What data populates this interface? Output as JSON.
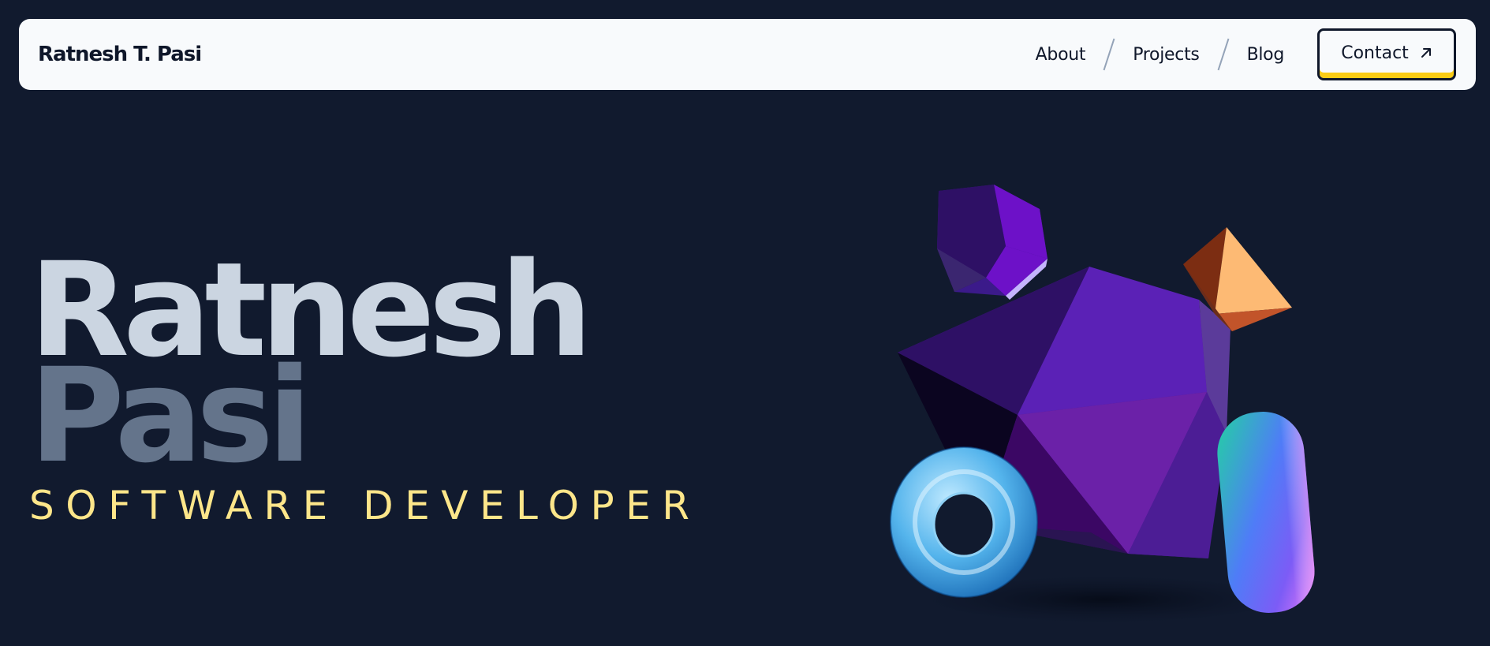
{
  "nav": {
    "brand": "Ratnesh T. Pasi",
    "links": [
      "About",
      "Projects",
      "Blog"
    ],
    "contact_label": "Contact",
    "contact_icon": "arrow-up-right-icon"
  },
  "hero": {
    "first_name": "Ratnesh",
    "last_name": "Pasi",
    "role": "SOFTWARE DEVELOPER"
  },
  "illustration": {
    "shapes": [
      "icosahedron",
      "dodecahedron",
      "octahedron",
      "torus",
      "capsule"
    ]
  },
  "colors": {
    "background": "#111a2e",
    "nav_background": "#f8fafc",
    "accent": "#facc15",
    "first_name": "#cbd5e1",
    "last_name": "#64748b",
    "role": "#fde68a"
  }
}
